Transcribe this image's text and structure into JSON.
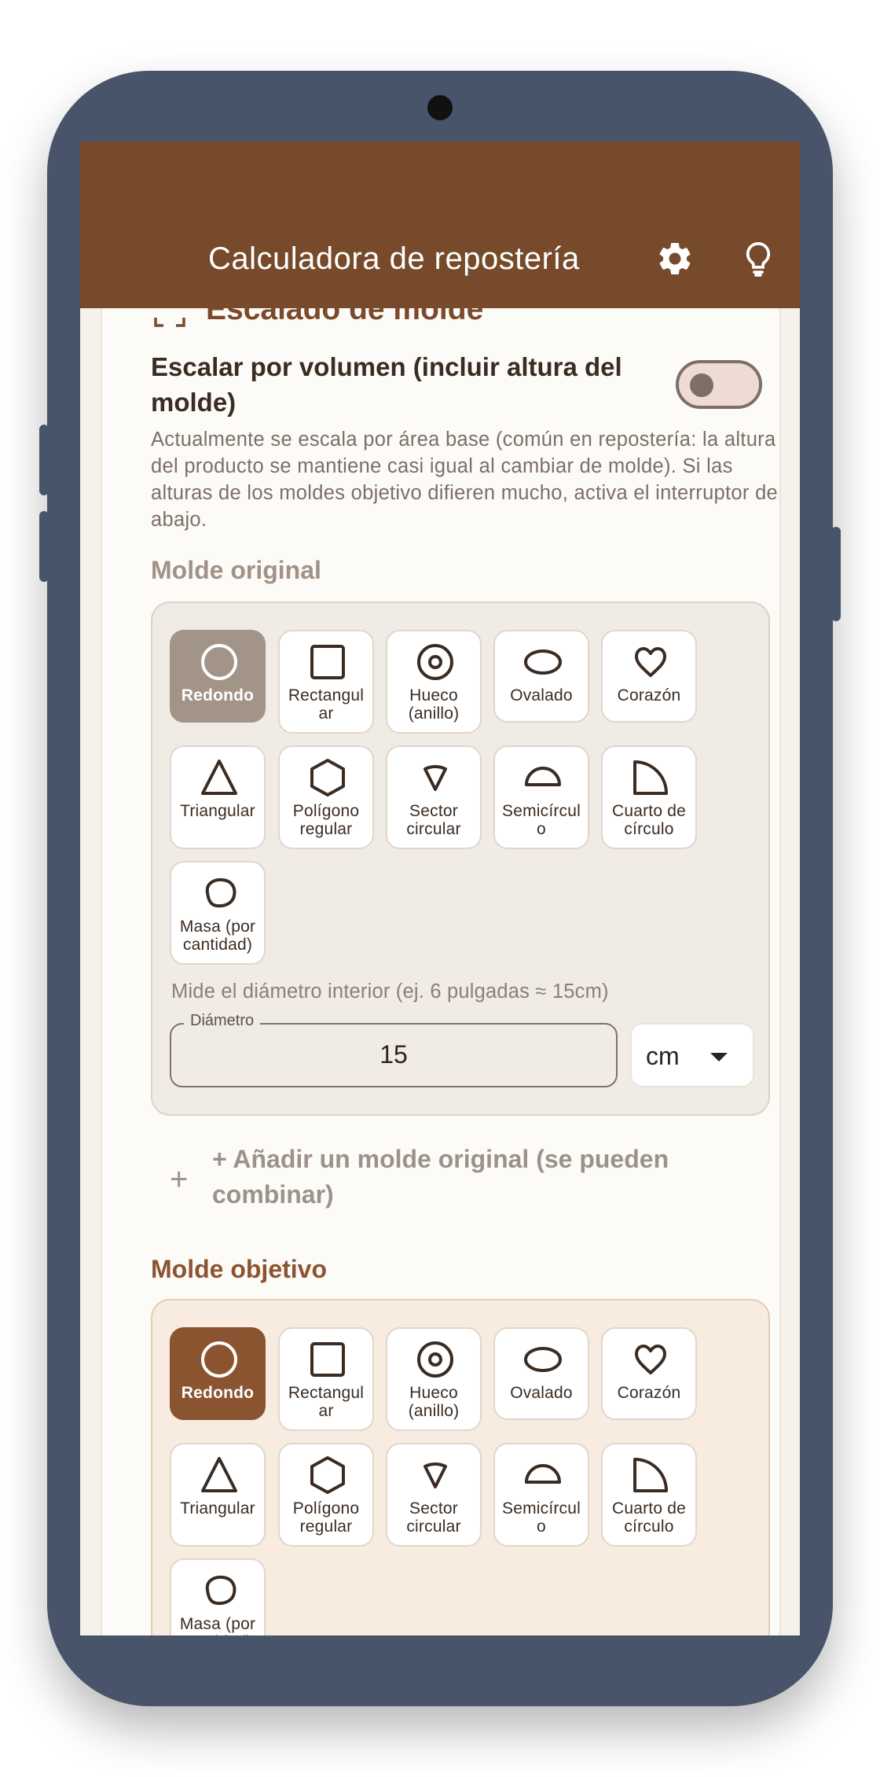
{
  "app": {
    "title": "Calculadora de repostería",
    "icons": {
      "settings": "gear-icon",
      "tips": "lightbulb-icon"
    }
  },
  "section": {
    "title": "Escalado de molde",
    "icon": "crop-frame-icon",
    "volume_toggle_label": "Escalar por volumen (incluir altura del molde)",
    "volume_toggle_on": false,
    "description": "Actualmente se escala por área base (común en repostería: la altura del producto se mantiene casi igual al cambiar de molde). Si las alturas de los moldes objetivo difieren mucho, activa el interruptor de abajo."
  },
  "original": {
    "heading": "Molde original",
    "selected": "Redondo",
    "shapes": [
      "Redondo",
      "Rectangular",
      "Hueco (anillo)",
      "Ovalado",
      "Corazón",
      "Triangular",
      "Polígono regular",
      "Sector circular",
      "Semicírculo",
      "Cuarto de círculo",
      "Masa (por cantidad)"
    ],
    "shape_labels": {
      "redondo": "Redondo",
      "rectangular": "Rectangul\nar",
      "hueco": "Hueco\n(anillo)",
      "ovalado": "Ovalado",
      "corazon": "Corazón",
      "triangular": "Triangular",
      "poligono": "Polígono\nregular",
      "sector": "Sector\ncircular",
      "semicirculo": "Semicírcul\no",
      "cuarto": "Cuarto de\ncírculo",
      "masa": "Masa (por\ncantidad)"
    },
    "hint": "Mide el diámetro interior (ej. 6 pulgadas ≈ 15cm)",
    "field_label": "Diámetro",
    "field_value": "15",
    "unit": "cm"
  },
  "add_original": "+ Añadir un molde original (se pueden combinar)",
  "target": {
    "heading": "Molde objetivo",
    "selected": "Redondo",
    "shape_labels": {
      "redondo": "Redondo",
      "rectangular": "Rectangul\nar",
      "hueco": "Hueco\n(anillo)",
      "ovalado": "Ovalado",
      "corazon": "Corazón",
      "triangular": "Triangular",
      "poligono": "Polígono\nregular",
      "sector": "Sector\ncircular",
      "semicirculo": "Semicírcul\no",
      "cuarto": "Cuarto de\ncírculo",
      "masa": "Masa (por\ncantidad)"
    }
  },
  "colors": {
    "appbar": "#764a2a",
    "accent": "#7a4a2a",
    "selected_original": "#a29588",
    "selected_target": "#8a5430"
  }
}
